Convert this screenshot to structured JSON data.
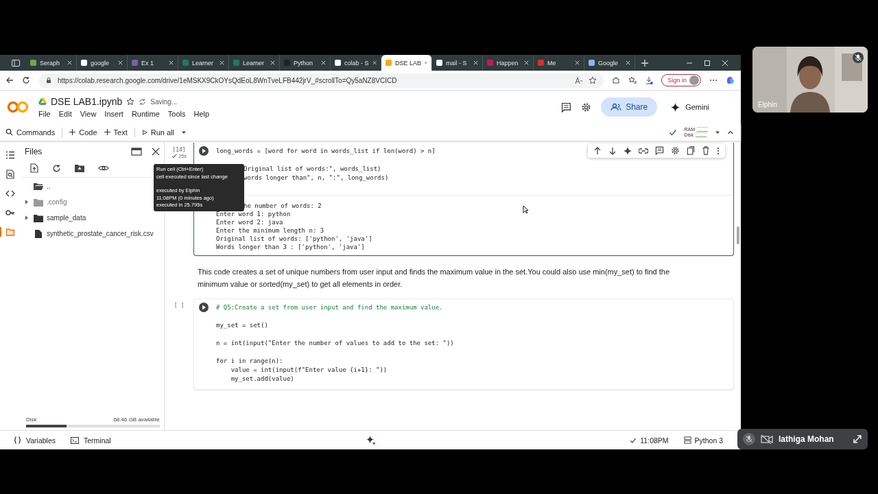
{
  "browser": {
    "tabs": [
      {
        "title": "Seraph",
        "selected": false,
        "color": "#6aa84f"
      },
      {
        "title": "google",
        "selected": false,
        "color": "#ffffff"
      },
      {
        "title": "Ex 1",
        "selected": false,
        "color": "#7b5ea7"
      },
      {
        "title": "Learner",
        "selected": false,
        "color": "#1e7a5a"
      },
      {
        "title": "Learner",
        "selected": false,
        "color": "#1e7a5a"
      },
      {
        "title": "Python",
        "selected": false,
        "color": "#222222"
      },
      {
        "title": "colab - S",
        "selected": false,
        "color": "#ffffff"
      },
      {
        "title": "DSE LAB",
        "selected": true,
        "color": "#f9ab00"
      },
      {
        "title": "mail - S",
        "selected": false,
        "color": "#ffffff"
      },
      {
        "title": "Happen",
        "selected": false,
        "color": "#c2185b"
      },
      {
        "title": "Me",
        "selected": false,
        "color": "#d93025"
      },
      {
        "title": "Google",
        "selected": false,
        "color": "#8ab4f8"
      }
    ],
    "url": "https://colab.research.google.com/drive/1eMSKX9CkOYsQdEoL8WnTveLFB442jrV_#scrollTo=Qy5aNZ8VCICD",
    "sign_in": "Sign in"
  },
  "colab": {
    "title": "DSE LAB1.ipynb",
    "status": "Saving...",
    "menu": [
      "File",
      "Edit",
      "View",
      "Insert",
      "Runtime",
      "Tools",
      "Help"
    ],
    "share": "Share",
    "gemini": "Gemini",
    "toolbar": [
      "Commands",
      "Code",
      "Text",
      "Run all"
    ],
    "ram": "RAM",
    "disk": "Disk"
  },
  "rail": [
    {
      "kind": "toc",
      "selected": false
    },
    {
      "kind": "find",
      "selected": false
    },
    {
      "kind": "code",
      "selected": false
    },
    {
      "kind": "key",
      "selected": false
    },
    {
      "kind": "folder",
      "selected": true
    }
  ],
  "files": {
    "title": "Files",
    "tree": [
      {
        "name": "..",
        "kind": "parent"
      },
      {
        "name": ".config",
        "kind": "folder",
        "expanded": false,
        "hidden": true
      },
      {
        "name": "sample_data",
        "kind": "folder",
        "expanded": false,
        "hidden": false
      },
      {
        "name": "synthetic_prostate_cancer_risk.csv",
        "kind": "file"
      }
    ],
    "disk_label": "Disk",
    "disk_free": "68.46 GB available",
    "disk": {
      "level": 0.3
    }
  },
  "cells": [
    {
      "kind": "code",
      "count": "[14]",
      "duration": "25s",
      "focused": true,
      "blocks": [
        [
          {
            "text": "long_words = [word for word in words_list if len(word) > n]"
          }
        ],
        [
          {
            "text": "Original list of words:\", words_list)",
            "covered": true
          },
          {
            "text": "words longer than\", n, \":\", long_words)",
            "covered": true
          }
        ]
      ],
      "output": [
        {
          "text": "he number of words: 2",
          "covered": true
        },
        {
          "text": "Enter word 1: python"
        },
        {
          "text": "Enter word 2: java"
        },
        {
          "text": "Enter the minimum length n: 3"
        },
        {
          "text": "Original list of words: ['python', 'java']"
        },
        {
          "text": "Words longer than 3 : ['python', 'java']"
        }
      ]
    },
    {
      "kind": "text",
      "text": "This code creates a set of unique numbers from user input and finds the maximum value in the set.You could also use min(my_set) to find the minimum value or sorted(my_set) to get all elements in order."
    },
    {
      "kind": "code",
      "count": "[ ]",
      "focused": false,
      "blocks": [
        [
          {
            "text": "# Q5:Create a set from user input and find the maximum value.",
            "comment": true
          }
        ],
        [
          {
            "text": "my_set = set()"
          }
        ],
        [
          {
            "text": "n = int(input(\"Enter the number of values to add to the set: \"))"
          }
        ],
        [
          {
            "text": "for i in range(n):"
          },
          {
            "text": "    value = int(input(f\"Enter value {i+1}: \"))"
          },
          {
            "text": "    my_set.add(value)"
          }
        ]
      ]
    }
  ],
  "tooltip": [
    "Run cell (Ctrl+Enter)",
    "cell executed since last change",
    "executed by Elphin",
    "11:08PM (0 minutes ago)",
    "executed in 25.795s"
  ],
  "status_bar": {
    "variables": "Variables",
    "terminal": "Terminal",
    "time": "11:08PM",
    "runtime": "Python 3"
  },
  "call": {
    "tile_name": "Elphin",
    "tile_muted": true,
    "self_name": "lathiga Mohan",
    "self_muted": true,
    "self_camera_off": true
  }
}
